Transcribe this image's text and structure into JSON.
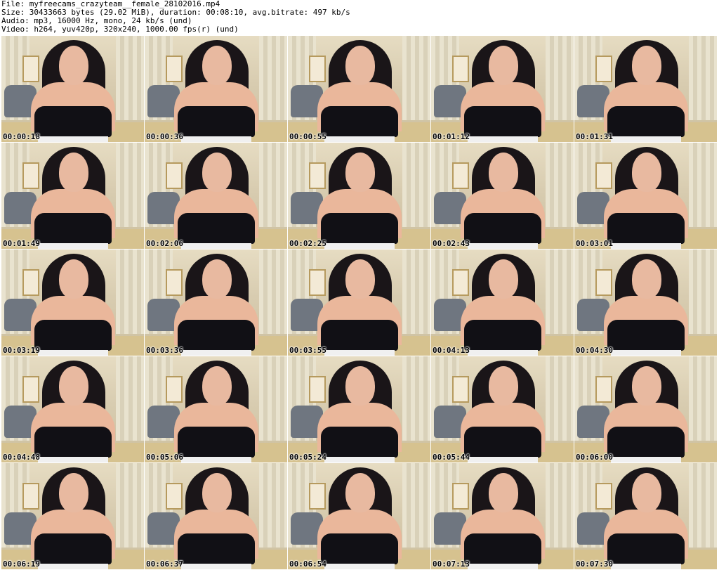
{
  "header": {
    "file_line": "File: myfreecams_crazyteam__female_28102016.mp4",
    "size_line": "Size: 30433663 bytes (29.02 MiB), duration: 00:08:10, avg.bitrate: 497 kb/s",
    "audio_line": "Audio: mp3, 16000 Hz, mono, 24 kb/s (und)",
    "video_line": "Video: h264, yuv420p, 320x240, 1000.00 fps(r) (und)"
  },
  "thumbnails": [
    {
      "timestamp": "00:00:18"
    },
    {
      "timestamp": "00:00:36"
    },
    {
      "timestamp": "00:00:55"
    },
    {
      "timestamp": "00:01:12"
    },
    {
      "timestamp": "00:01:31"
    },
    {
      "timestamp": "00:01:49"
    },
    {
      "timestamp": "00:02:06"
    },
    {
      "timestamp": "00:02:25"
    },
    {
      "timestamp": "00:02:43"
    },
    {
      "timestamp": "00:03:01"
    },
    {
      "timestamp": "00:03:19"
    },
    {
      "timestamp": "00:03:36"
    },
    {
      "timestamp": "00:03:55"
    },
    {
      "timestamp": "00:04:13"
    },
    {
      "timestamp": "00:04:30"
    },
    {
      "timestamp": "00:04:48"
    },
    {
      "timestamp": "00:05:06"
    },
    {
      "timestamp": "00:05:24"
    },
    {
      "timestamp": "00:05:44"
    },
    {
      "timestamp": "00:06:00"
    },
    {
      "timestamp": "00:06:19"
    },
    {
      "timestamp": "00:06:37"
    },
    {
      "timestamp": "00:06:54"
    },
    {
      "timestamp": "00:07:13"
    },
    {
      "timestamp": "00:07:30"
    }
  ]
}
